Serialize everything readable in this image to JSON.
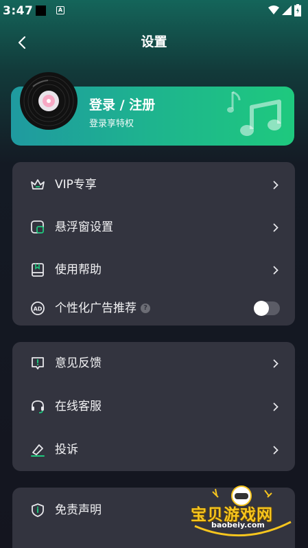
{
  "status_bar": {
    "time": "3:47",
    "a_icon": "A"
  },
  "header": {
    "title": "设置"
  },
  "login": {
    "title": "登录 / 注册",
    "subtitle": "登录享特权"
  },
  "group1": {
    "items": [
      {
        "label": "VIP专享",
        "icon": "crown-icon"
      },
      {
        "label": "悬浮窗设置",
        "icon": "floating-window-icon"
      },
      {
        "label": "使用帮助",
        "icon": "help-book-icon"
      },
      {
        "label": "个性化广告推荐",
        "icon": "ad-icon",
        "help_mark": "?",
        "toggle_on": false
      }
    ]
  },
  "group2": {
    "items": [
      {
        "label": "意见反馈",
        "icon": "feedback-icon"
      },
      {
        "label": "在线客服",
        "icon": "headset-icon"
      },
      {
        "label": "投诉",
        "icon": "complaint-icon"
      }
    ]
  },
  "group3": {
    "items": [
      {
        "label": "免责声明",
        "icon": "shield-info-icon"
      }
    ]
  },
  "watermark": {
    "cn": "宝贝游戏网",
    "en": "baobeiy.com"
  },
  "colors": {
    "card_bg": "#33343f",
    "accent_green": "#1ec97e",
    "accent_teal": "#1f9aa0",
    "page_bg": "#14151f"
  }
}
